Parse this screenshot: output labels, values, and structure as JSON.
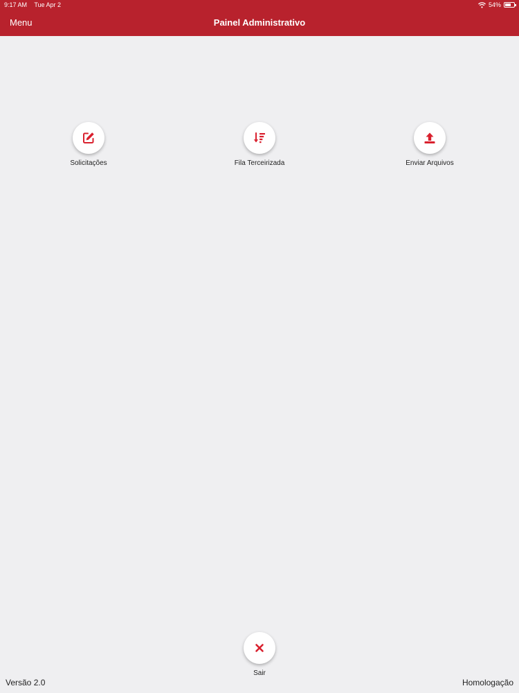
{
  "status_bar": {
    "time": "9:17 AM",
    "date": "Tue Apr 2",
    "battery": "54%"
  },
  "navbar": {
    "menu_label": "Menu",
    "title": "Painel Administrativo"
  },
  "actions": [
    {
      "label": "Solicitações",
      "icon": "edit-icon"
    },
    {
      "label": "Fila Terceirizada",
      "icon": "sort-list-icon"
    },
    {
      "label": "Enviar Arquivos",
      "icon": "upload-icon"
    }
  ],
  "logout": {
    "label": "Sair",
    "icon": "close-icon"
  },
  "footer": {
    "version": "Versão 2.0",
    "environment": "Homologação"
  },
  "colors": {
    "brand": "#b8222d",
    "icon": "#d9202e",
    "background": "#efeff1"
  }
}
